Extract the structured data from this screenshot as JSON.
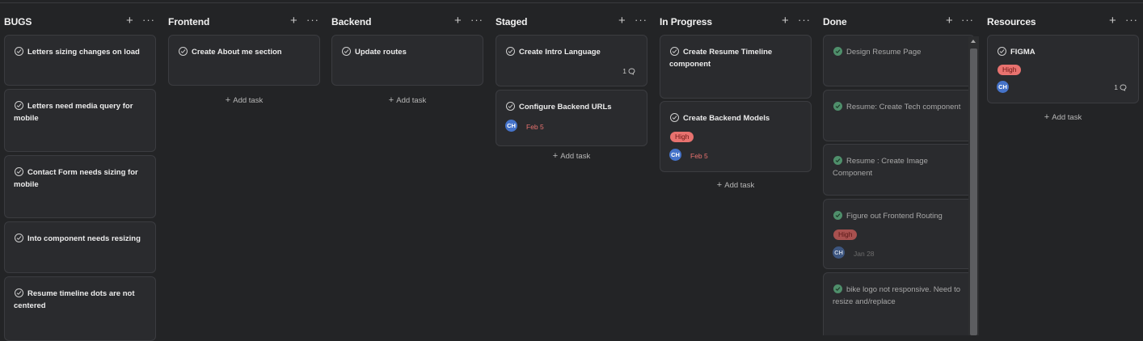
{
  "columns": [
    {
      "title": "BUGS",
      "add_icon": "+",
      "more_icon": "···",
      "cards": [
        {
          "title": "Letters sizing changes on load"
        },
        {
          "title": "Letters need media query for mobile"
        },
        {
          "title": "Contact Form needs sizing for mobile"
        },
        {
          "title": "Into component needs resizing"
        },
        {
          "title": "Resume timeline dots are not centered"
        }
      ]
    },
    {
      "title": "Frontend",
      "add_icon": "+",
      "more_icon": "···",
      "cards": [
        {
          "title": "Create About me section"
        }
      ],
      "add_task": "Add task"
    },
    {
      "title": "Backend",
      "add_icon": "+",
      "more_icon": "···",
      "cards": [
        {
          "title": "Update routes"
        }
      ],
      "add_task": "Add task"
    },
    {
      "title": "Staged",
      "add_icon": "+",
      "more_icon": "···",
      "cards": [
        {
          "title": "Create Intro Language",
          "comments": "1"
        },
        {
          "title": "Configure Backend URLs",
          "assignee": "CH",
          "due": "Feb 5"
        }
      ],
      "add_task": "Add task"
    },
    {
      "title": "In Progress",
      "add_icon": "+",
      "more_icon": "···",
      "cards": [
        {
          "title": "Create Resume Timeline component"
        },
        {
          "title": "Create Backend Models",
          "priority": "High",
          "assignee": "CH",
          "due": "Feb 5"
        }
      ],
      "add_task": "Add task"
    },
    {
      "title": "Done",
      "add_icon": "+",
      "more_icon": "···",
      "cards": [
        {
          "title": "Design Resume Page"
        },
        {
          "title": "Resume: Create Tech component"
        },
        {
          "title": "Resume : Create Image Component"
        },
        {
          "title": "Figure out Frontend Routing",
          "priority": "High",
          "assignee": "CH",
          "due": "Jan 28"
        },
        {
          "title": "bike logo not responsive. Need to resize and/replace"
        }
      ]
    },
    {
      "title": "Resources",
      "add_icon": "+",
      "more_icon": "···",
      "cards": [
        {
          "title": "FIGMA",
          "priority": "High",
          "assignee": "CH",
          "comments": "1"
        }
      ],
      "add_task": "Add task"
    }
  ],
  "colors": {
    "background": "#232426",
    "card": "#2a2b2e",
    "priority_high": "#e8726f",
    "avatar": "#4573c9",
    "done_check": "#4f8f6b"
  }
}
